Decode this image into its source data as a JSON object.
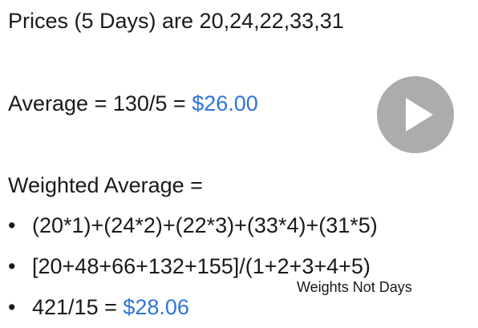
{
  "slide": {
    "prices_line": "Prices (5 Days) are 20,24,22,33,31",
    "average_prefix": "Average = 130/5 = ",
    "average_value": "$26.00",
    "weighted_heading": "Weighted Average =",
    "bullets": [
      {
        "marker": "•",
        "text": "(20*1)+(24*2)+(22*3)+(33*4)+(31*5)",
        "value": ""
      },
      {
        "marker": "•",
        "text": "[20+48+66+132+155]/(1+2+3+4+5)",
        "value": ""
      },
      {
        "marker": "•",
        "text": "421/15 = ",
        "value": "$28.06"
      }
    ],
    "note": "Weights Not Days"
  },
  "player": {
    "play_icon": "play-icon"
  },
  "colors": {
    "accent": "#2e75d6",
    "play_button": "#9e9e9e"
  }
}
